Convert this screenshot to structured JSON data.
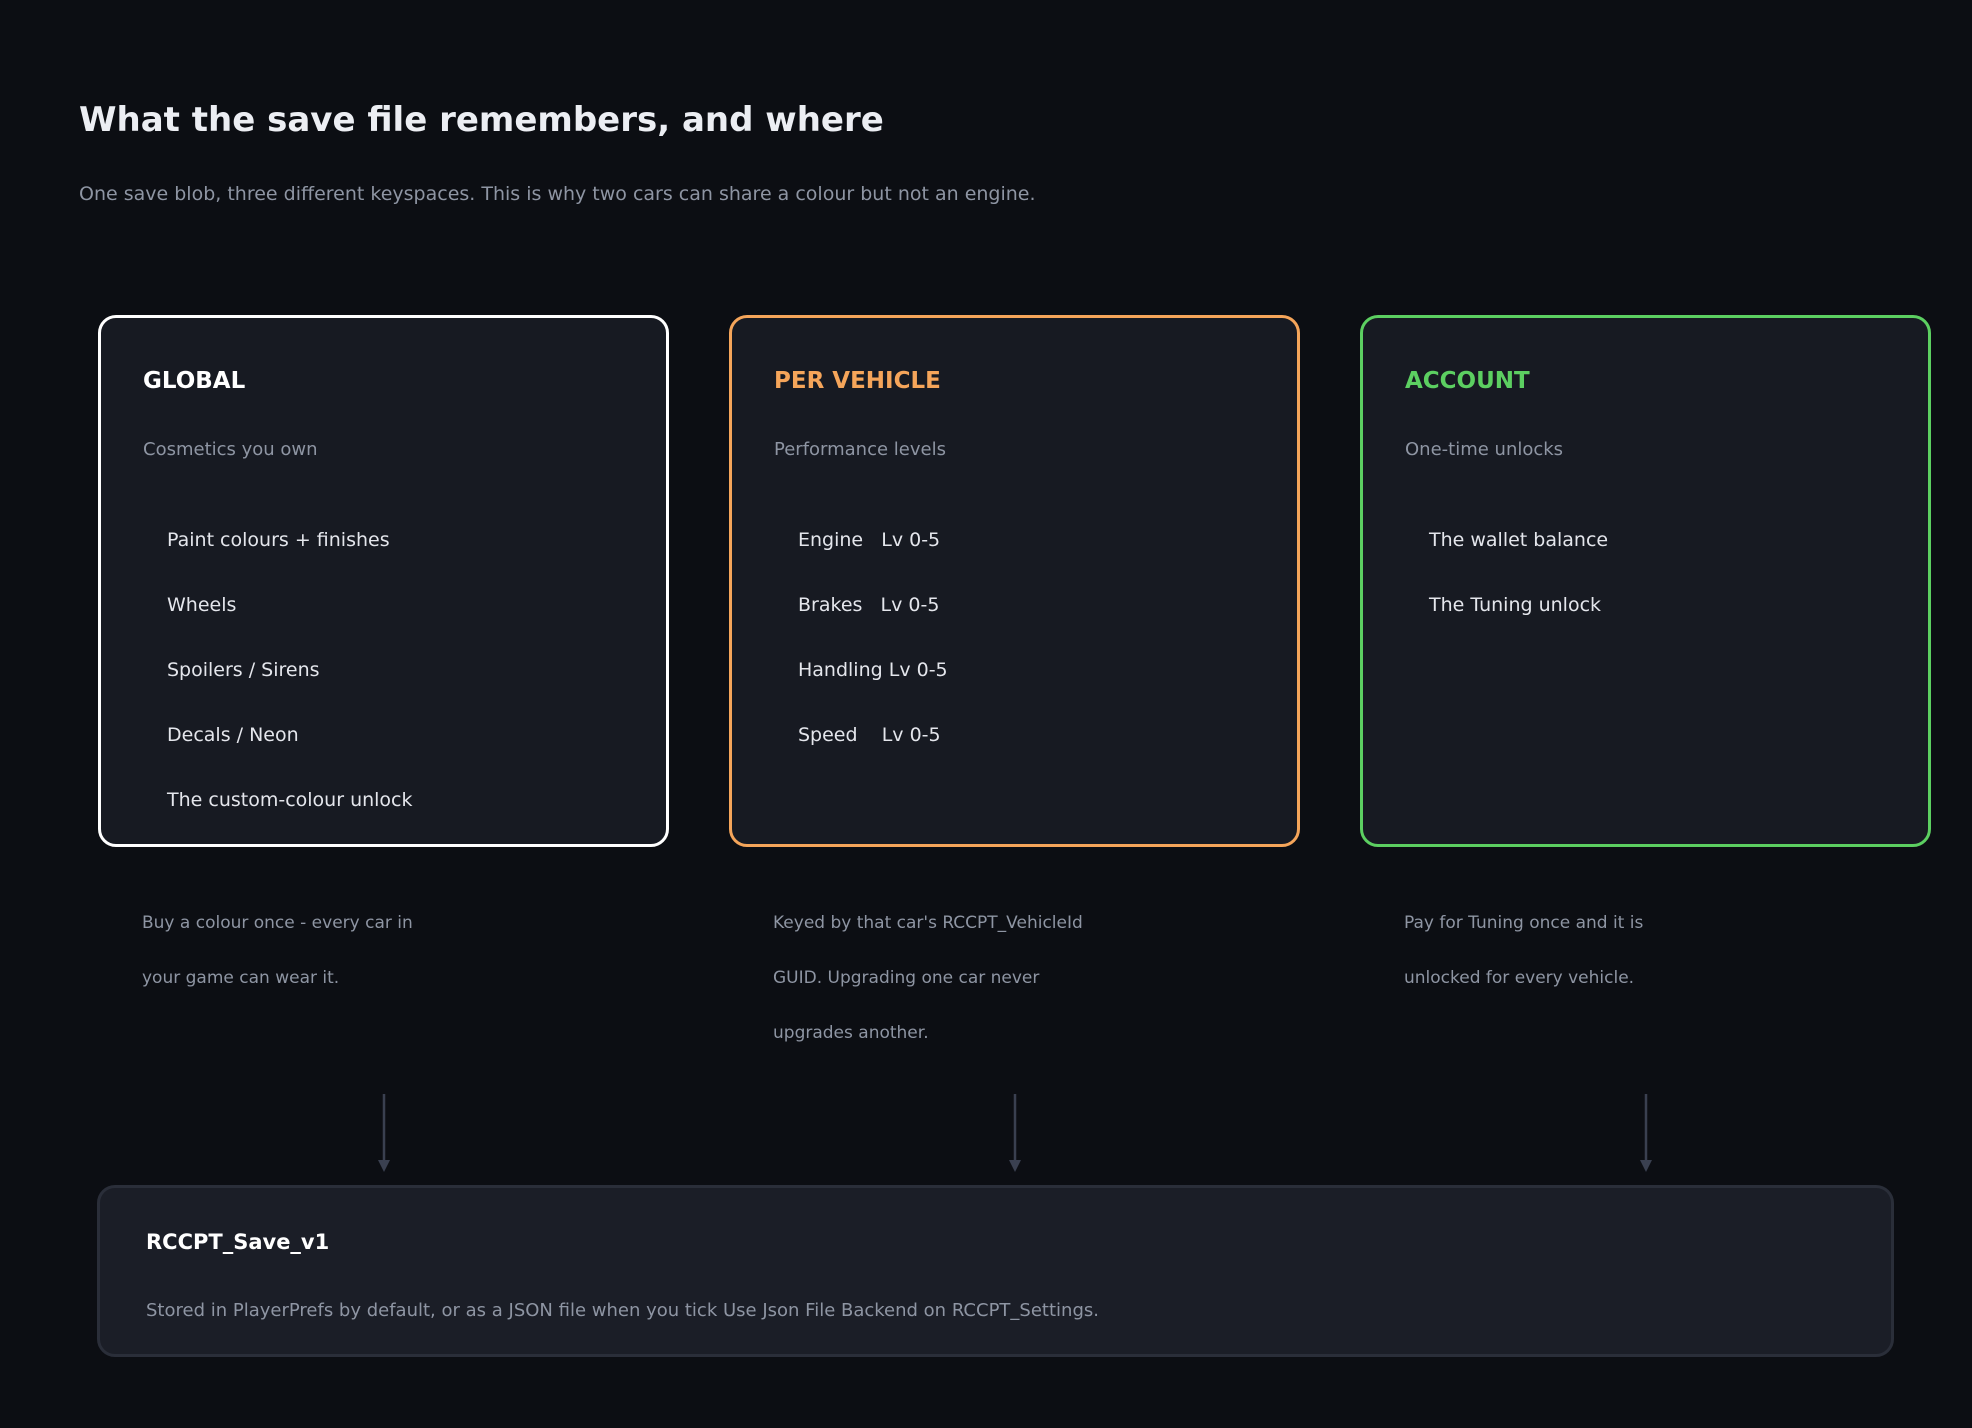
{
  "header": {
    "title": "What the save file remembers, and where",
    "subtitle": "One save blob, three different keyspaces. This is why two cars can share a colour but not an engine."
  },
  "columns": [
    {
      "title": "GLOBAL",
      "subtitle": "Cosmetics you own",
      "items": [
        "Paint colours + finishes",
        "Wheels",
        "Spoilers / Sirens",
        "Decals / Neon",
        "The custom-colour unlock"
      ],
      "note_lines": [
        "Buy a colour once - every car in",
        "your game can wear it."
      ],
      "color": "#ffffff"
    },
    {
      "title": "PER VEHICLE",
      "subtitle": "Performance levels",
      "items": [
        "Engine   Lv 0-5",
        "Brakes   Lv 0-5",
        "Handling Lv 0-5",
        "Speed    Lv 0-5"
      ],
      "note_lines": [
        "Keyed by that car's RCCPT_VehicleId",
        "GUID. Upgrading one car never",
        "upgrades another."
      ],
      "color": "#f5a55a"
    },
    {
      "title": "ACCOUNT",
      "subtitle": "One-time unlocks",
      "items": [
        "The wallet balance",
        "The Tuning unlock"
      ],
      "note_lines": [
        "Pay for Tuning once and it is",
        "unlocked for every vehicle."
      ],
      "color": "#5ccf61"
    }
  ],
  "storage": {
    "title": "RCCPT_Save_v1",
    "description": "Stored in PlayerPrefs by default, or as a JSON file when you tick Use Json File Backend on RCCPT_Settings."
  },
  "colors": {
    "background": "#0c0e13",
    "card": "#171a22",
    "arrow": "#3a4050"
  }
}
